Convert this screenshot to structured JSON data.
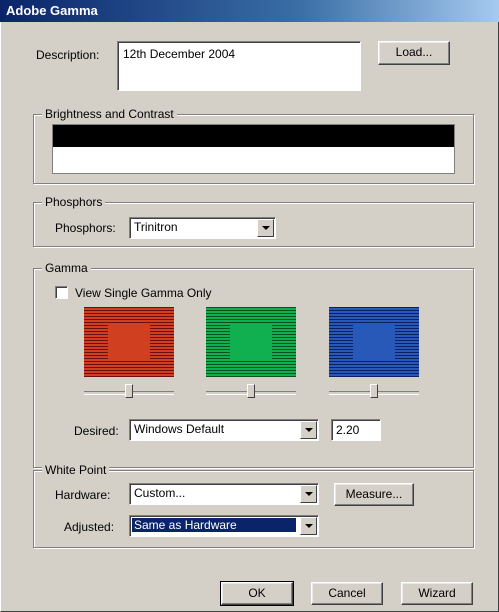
{
  "window": {
    "title": "Adobe Gamma"
  },
  "description": {
    "label": "Description:",
    "value": "12th December 2004",
    "load_label": "Load..."
  },
  "brightness": {
    "group_label": "Brightness and Contrast"
  },
  "phosphors": {
    "group_label": "Phosphors",
    "label": "Phosphors:",
    "value": "Trinitron"
  },
  "gamma": {
    "group_label": "Gamma",
    "single_label": "View Single Gamma Only",
    "single_checked": false,
    "channels": [
      {
        "name": "red",
        "color": "#d04020",
        "stripe": "#6b1010",
        "slider_value": 0.5
      },
      {
        "name": "green",
        "color": "#10b050",
        "stripe": "#0b5020",
        "slider_value": 0.5
      },
      {
        "name": "blue",
        "color": "#2858b8",
        "stripe": "#0a2060",
        "slider_value": 0.5
      }
    ],
    "desired_label": "Desired:",
    "desired_value": "Windows Default",
    "desired_number": "2.20"
  },
  "white_point": {
    "group_label": "White Point",
    "hardware_label": "Hardware:",
    "hardware_value": "Custom...",
    "measure_label": "Measure...",
    "adjusted_label": "Adjusted:",
    "adjusted_value": "Same as Hardware"
  },
  "footer": {
    "ok_label": "OK",
    "cancel_label": "Cancel",
    "wizard_label": "Wizard"
  }
}
